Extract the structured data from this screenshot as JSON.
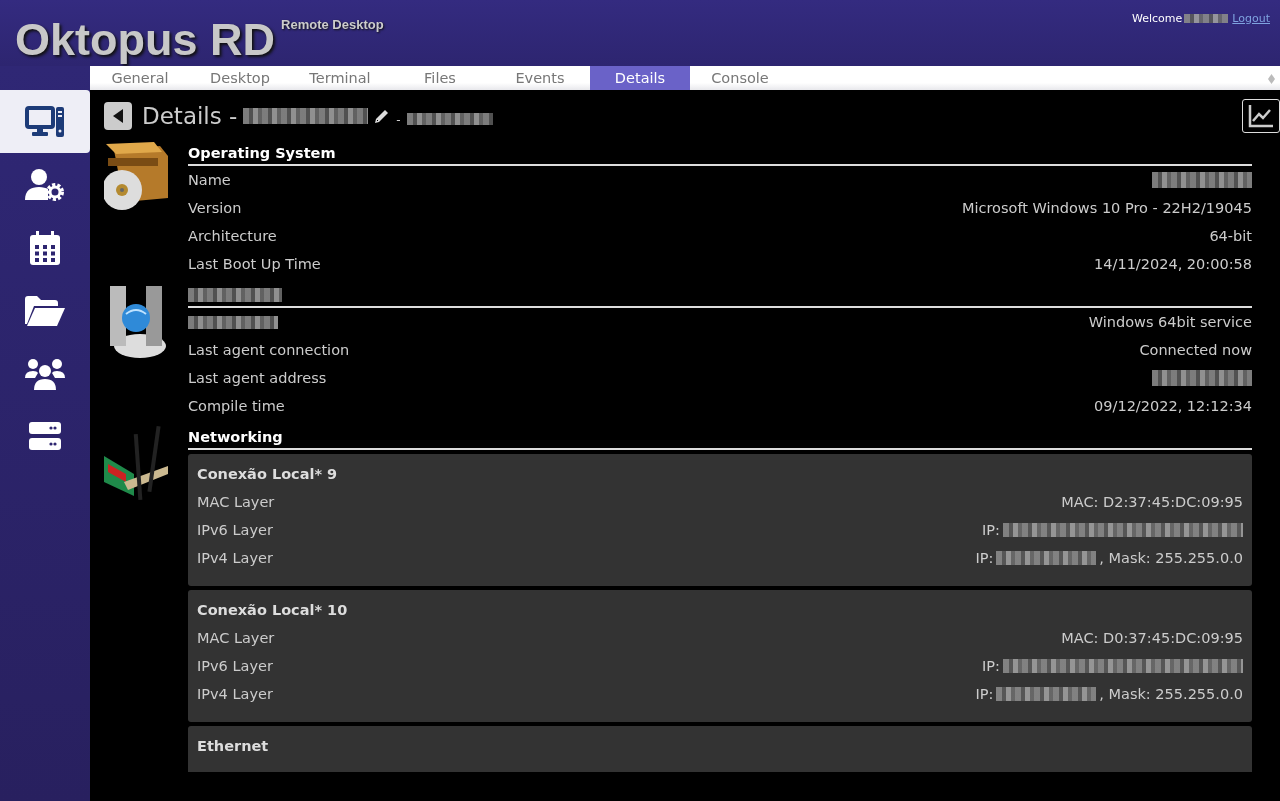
{
  "header": {
    "title": "Oktopus RD",
    "subtitle": "Remote Desktop",
    "welcome": "Welcome",
    "welcome_name_redacted": true,
    "logout": "Logout"
  },
  "sidebar": {
    "items": [
      {
        "kind": "computer",
        "selected": true
      },
      {
        "kind": "user-gear",
        "selected": false
      },
      {
        "kind": "calendar",
        "selected": false
      },
      {
        "kind": "folder",
        "selected": false
      },
      {
        "kind": "users",
        "selected": false
      },
      {
        "kind": "servers",
        "selected": false
      }
    ]
  },
  "tabs": [
    {
      "label": "General",
      "selected": false
    },
    {
      "label": "Desktop",
      "selected": false
    },
    {
      "label": "Terminal",
      "selected": false
    },
    {
      "label": "Files",
      "selected": false
    },
    {
      "label": "Events",
      "selected": false
    },
    {
      "label": "Details",
      "selected": true
    },
    {
      "label": "Console",
      "selected": false
    }
  ],
  "page": {
    "title": "Details -",
    "name_redacted": true,
    "suffix": "-"
  },
  "sections": [
    {
      "kind": "os",
      "title": "Operating System",
      "rows": [
        {
          "label": "Name",
          "value_redacted": true
        },
        {
          "label": "Version",
          "value": "Microsoft Windows 10 Pro - 22H2/19045"
        },
        {
          "label": "Architecture",
          "value": "64-bit"
        },
        {
          "label": "Last Boot Up Time",
          "value": "14/11/2024, 20:00:58"
        }
      ]
    },
    {
      "kind": "agent",
      "title_redacted": true,
      "rows": [
        {
          "label_redacted": true,
          "value": "Windows 64bit service"
        },
        {
          "label": "Last agent connection",
          "value": "Connected now"
        },
        {
          "label": "Last agent address",
          "value_redacted": true
        },
        {
          "label": "Compile time",
          "value": "09/12/2022, 12:12:34"
        }
      ]
    },
    {
      "kind": "network",
      "title": "Networking",
      "interfaces": [
        {
          "name": "Conexão Local* 9",
          "rows": [
            {
              "label": "MAC Layer",
              "value": "MAC: D2:37:45:DC:09:95"
            },
            {
              "label": "IPv6 Layer",
              "value": "IP:",
              "value_redacted": true
            },
            {
              "label": "IPv4 Layer",
              "value": "IP:",
              "value_redacted": true,
              "value_suffix": ", Mask: 255.255.0.0"
            }
          ]
        },
        {
          "name": "Conexão Local* 10",
          "rows": [
            {
              "label": "MAC Layer",
              "value": "MAC: D0:37:45:DC:09:95"
            },
            {
              "label": "IPv6 Layer",
              "value": "IP:",
              "value_redacted": true
            },
            {
              "label": "IPv4 Layer",
              "value": "IP:",
              "value_redacted": true,
              "value_suffix": ", Mask: 255.255.0.0"
            }
          ]
        },
        {
          "name": "Ethernet"
        }
      ]
    }
  ]
}
